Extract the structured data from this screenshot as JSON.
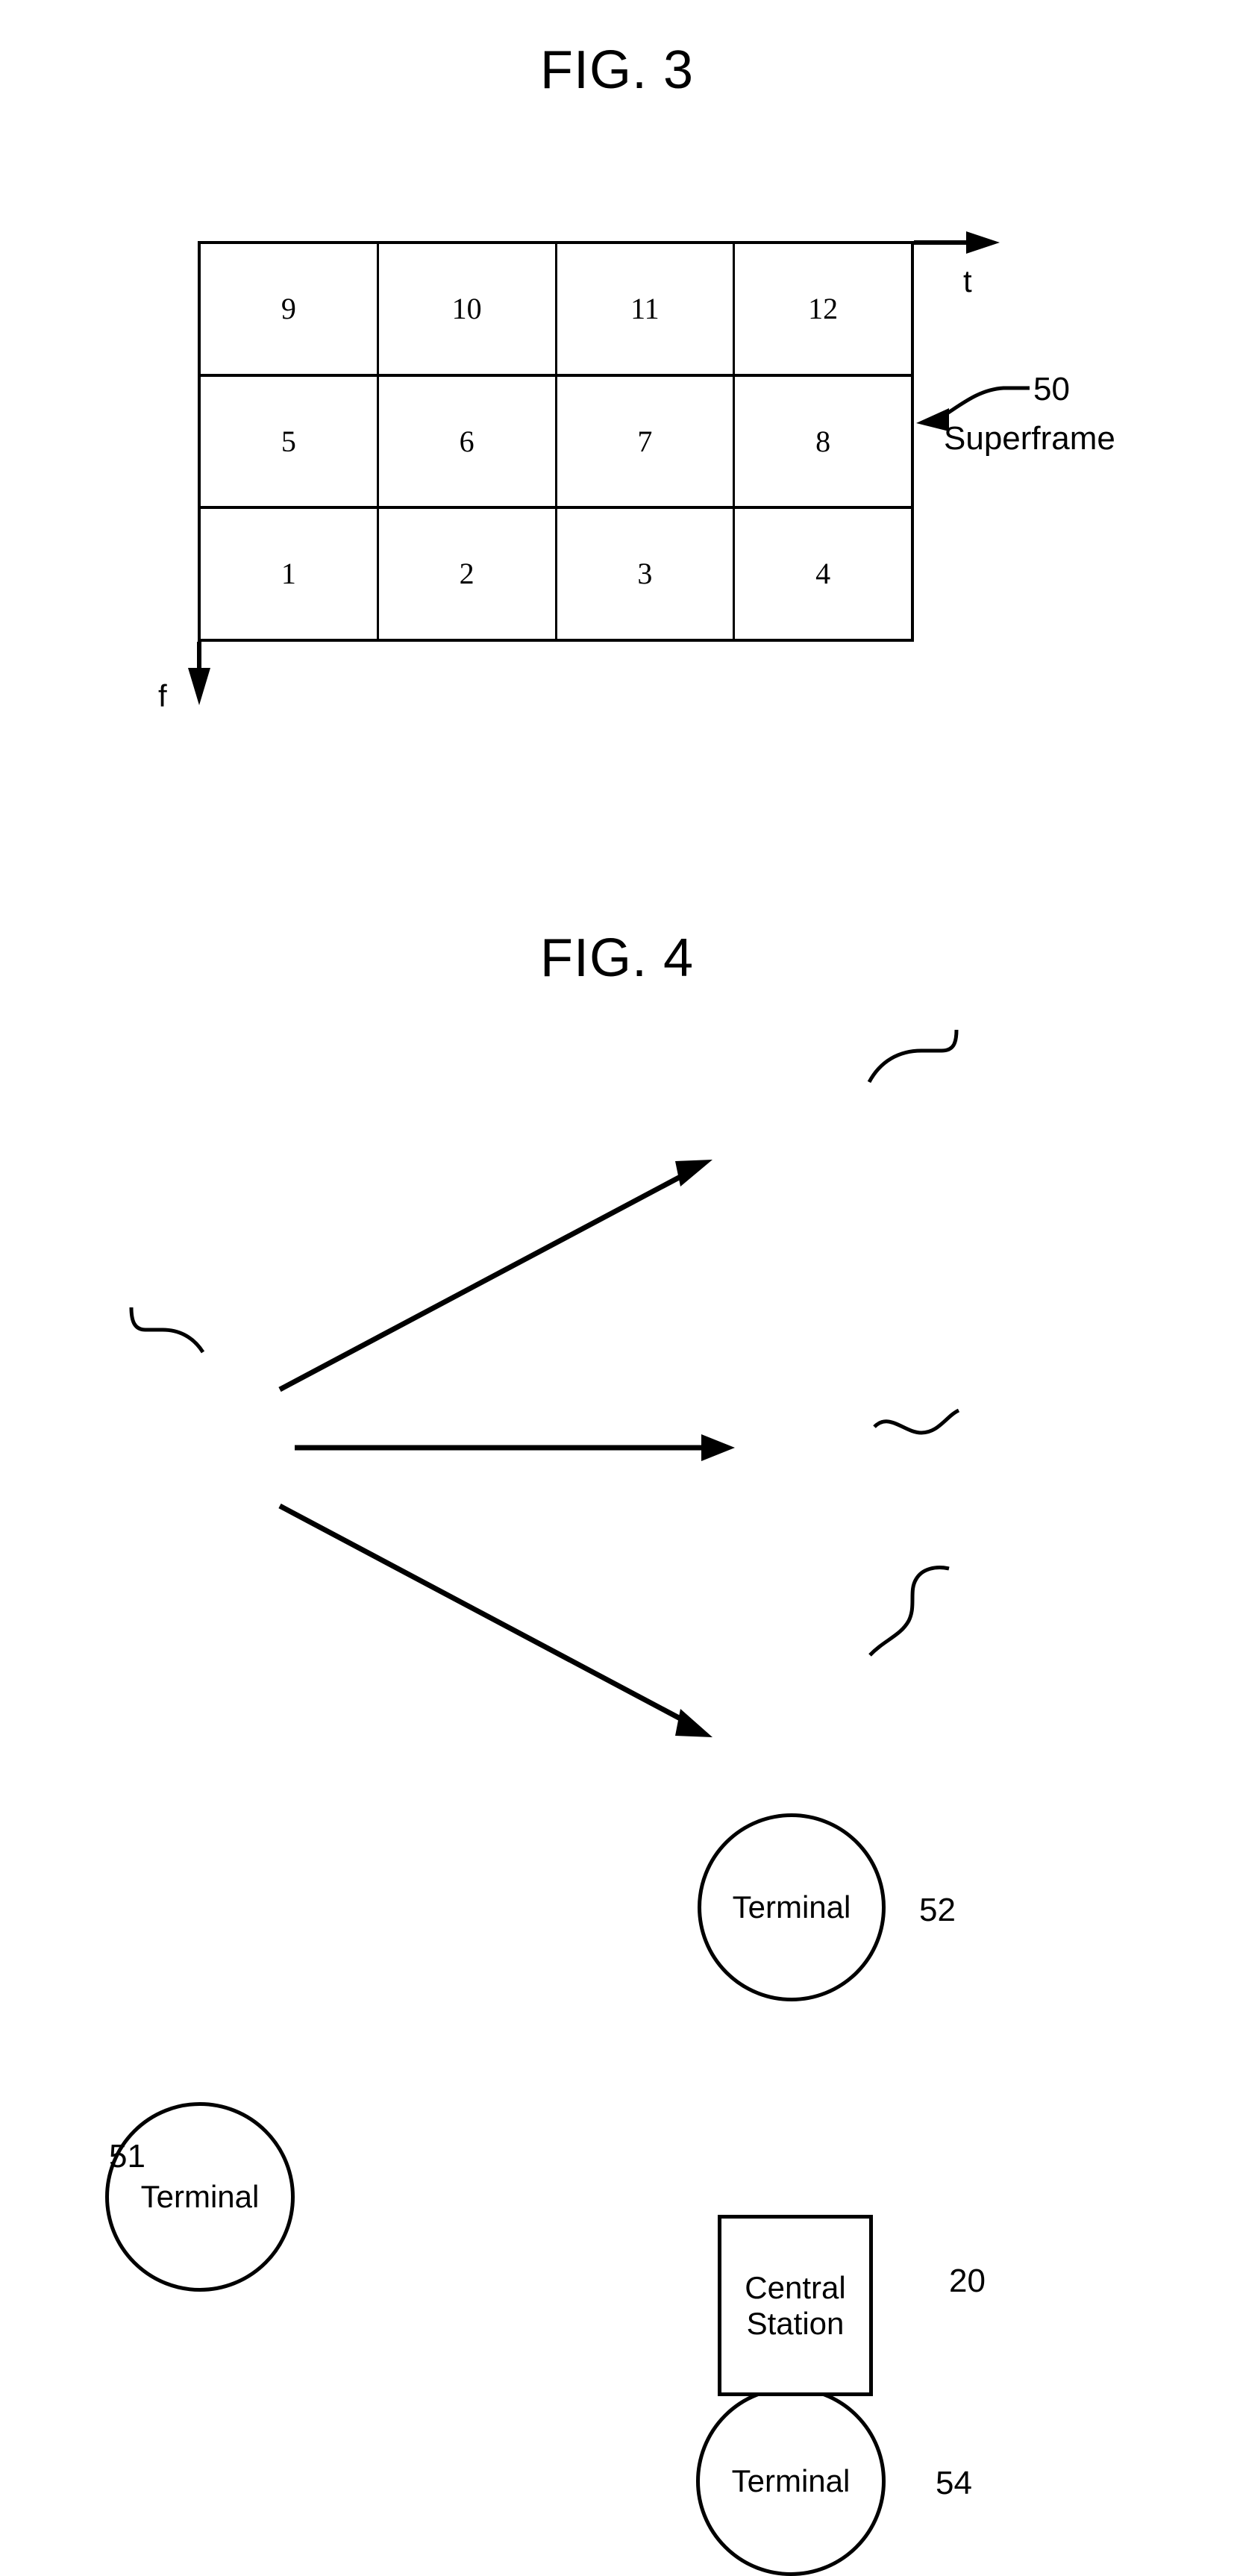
{
  "figures": [
    {
      "id": "fig3",
      "title": "FIG. 3",
      "axes": {
        "horizontal": "t",
        "vertical": "f"
      },
      "callout": {
        "number": "50",
        "label": "Superframe"
      }
    },
    {
      "id": "fig4",
      "title": "FIG. 4"
    }
  ],
  "fig3": {
    "title": "FIG. 3",
    "t_axis_label": "t",
    "f_axis_label": "f",
    "ref_50": "50",
    "superframe_label": "Superframe",
    "grid": {
      "rows": 3,
      "columns": 4,
      "cells": [
        [
          "9",
          "10",
          "11",
          "12"
        ],
        [
          "5",
          "6",
          "7",
          "8"
        ],
        [
          "1",
          "2",
          "3",
          "4"
        ]
      ]
    }
  },
  "fig4": {
    "title": "FIG. 4",
    "nodes": {
      "terminal_51": {
        "label": "Terminal",
        "ref": "51"
      },
      "terminal_52": {
        "label": "Terminal",
        "ref": "52"
      },
      "terminal_54": {
        "label": "Terminal",
        "ref": "54"
      },
      "central_station": {
        "line1": "Central",
        "line2": "Station",
        "ref": "20"
      }
    },
    "connections": [
      {
        "from": "terminal_51",
        "to": "terminal_52",
        "arrow": "to"
      },
      {
        "from": "terminal_51",
        "to": "central_station",
        "arrow": "to"
      },
      {
        "from": "terminal_51",
        "to": "terminal_54",
        "arrow": "to"
      }
    ]
  }
}
